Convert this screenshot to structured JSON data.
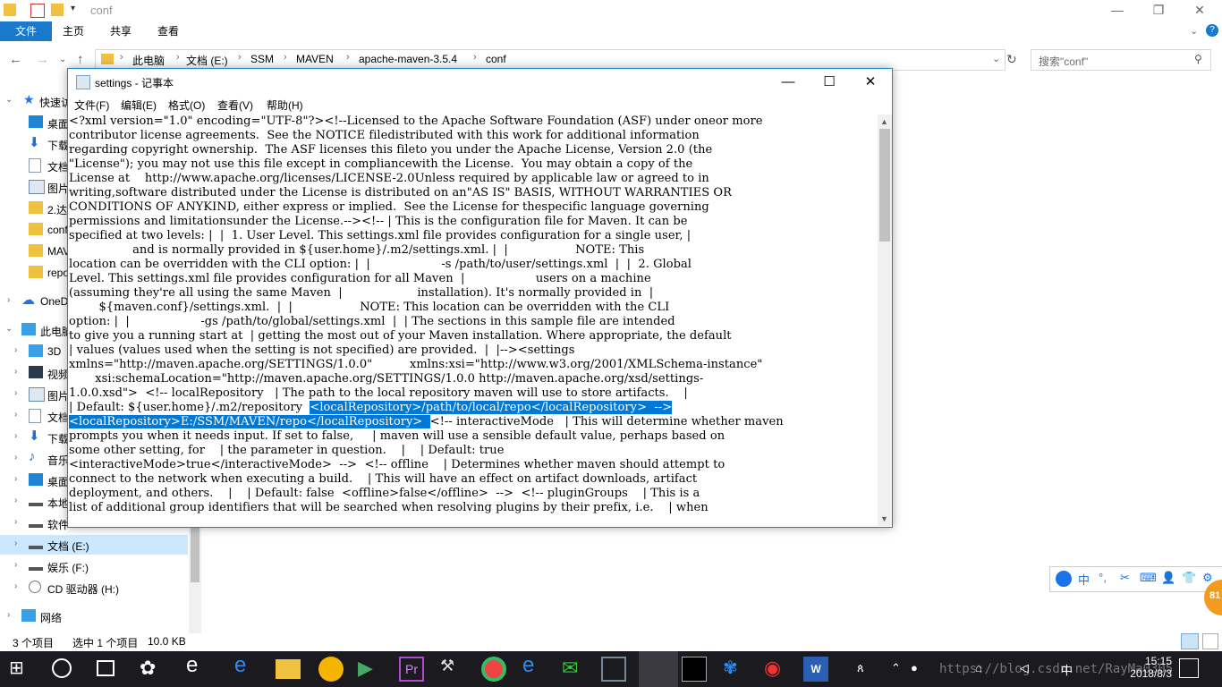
{
  "explorer": {
    "title": "conf",
    "tabs": [
      "文件",
      "主页",
      "共享",
      "查看"
    ],
    "breadcrumb": [
      "此电脑",
      "文档 (E:)",
      "SSM",
      "MAVEN",
      "apache-maven-3.5.4",
      "conf"
    ],
    "search_placeholder": "搜索\"conf\"",
    "nav": {
      "quick_access": "快速访",
      "items_quick": [
        "桌面",
        "下载",
        "文档",
        "图片",
        "2.达",
        "conf",
        "MAV",
        "repo"
      ],
      "onedrive": "OneD",
      "this_pc": "此电脑",
      "items_pc": [
        "3D",
        "视频",
        "图片",
        "文档",
        "下载",
        "音乐",
        "桌面",
        "本地",
        "软件"
      ],
      "drive_e": "文档 (E:)",
      "drive_f": "娱乐 (F:)",
      "drive_h": "CD 驱动器 (H:)",
      "network": "网络"
    },
    "status": {
      "count": "3 个项目",
      "selected": "选中 1 个项目",
      "size": "10.0 KB"
    }
  },
  "notepad": {
    "title": "settings - 记事本",
    "menu": [
      "文件(F)",
      "编辑(E)",
      "格式(O)",
      "查看(V)",
      "帮助(H)"
    ],
    "lines": [
      "<?xml version=\"1.0\" encoding=\"UTF-8\"?><!--Licensed to the Apache Software Foundation (ASF) under oneor more",
      "contributor license agreements.  See the NOTICE filedistributed with this work for additional information",
      "regarding copyright ownership.  The ASF licenses this fileto you under the Apache License, Version 2.0 (the",
      "\"License\"); you may not use this file except in compliancewith the License.  You may obtain a copy of the",
      "License at    http://www.apache.org/licenses/LICENSE-2.0Unless required by applicable law or agreed to in",
      "writing,software distributed under the License is distributed on an\"AS IS\" BASIS, WITHOUT WARRANTIES OR",
      "CONDITIONS OF ANYKIND, either express or implied.  See the License for thespecific language governing",
      "permissions and limitationsunder the License.--><!-- | This is the configuration file for Maven. It can be",
      "specified at two levels: |  |  1. User Level. This settings.xml file provides configuration for a single user, |",
      "                 and is normally provided in ${user.home}/.m2/settings.xml. |  |                  NOTE: This",
      "location can be overridden with the CLI option: |  |                   -s /path/to/user/settings.xml  |  |  2. Global",
      "Level. This settings.xml file provides configuration for all Maven  |                   users on a machine",
      "(assuming they're all using the same Maven  |                    installation). It's normally provided in  |",
      "        ${maven.conf}/settings.xml.  |  |                  NOTE: This location can be overridden with the CLI",
      "option: |  |                   -gs /path/to/global/settings.xml  |  | The sections in this sample file are intended",
      "to give you a running start at  | getting the most out of your Maven installation. Where appropriate, the default",
      "| values (values used when the setting is not specified) are provided.  |  |--><settings",
      "xmlns=\"http://maven.apache.org/SETTINGS/1.0.0\"          xmlns:xsi=\"http://www.w3.org/2001/XMLSchema-instance\"",
      "       xsi:schemaLocation=\"http://maven.apache.org/SETTINGS/1.0.0 http://maven.apache.org/xsd/settings-",
      "1.0.0.xsd\">  <!-- localRepository   | The path to the local repository maven will use to store artifacts.    |",
      "",
      "",
      "prompts you when it needs input. If set to false,     | maven will use a sensible default value, perhaps based on",
      "some other setting, for    | the parameter in question.    |    | Default: true",
      "<interactiveMode>true</interactiveMode>  -->  <!-- offline    | Determines whether maven should attempt to",
      "connect to the network when executing a build.    | This will have an effect on artifact downloads, artifact",
      "deployment, and others.    |    | Default: false  <offline>false</offline>  -->  <!-- pluginGroups    | This is a",
      "list of additional group identifiers that will be searched when resolving plugins by their prefix, i.e.    | when"
    ],
    "line20_pre": "| Default: ${user.home}/.m2/repository  ",
    "line20_hl": "<localRepository>/path/to/local/repo</localRepository>  -->",
    "line21_hl": "<localRepository>E:/SSM/MAVEN/repo</localRepository>  ",
    "line21_post": "<!-- interactiveMode   | This will determine whether maven"
  },
  "ime": {
    "items": [
      "中",
      "°,",
      "✂",
      "⌨",
      "👤",
      "👕",
      "⚙"
    ]
  },
  "badge": "81",
  "taskbar": {
    "time": "15:15",
    "date": "2018/8/3",
    "ime_lang": "中",
    "watermark": "https://blog.csdn.net/RayMa0305"
  }
}
